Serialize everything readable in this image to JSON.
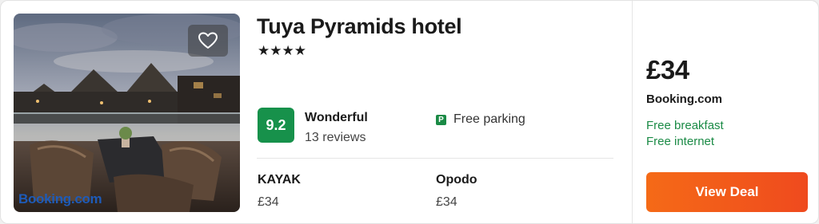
{
  "hotel": {
    "name": "Tuya Pyramids hotel",
    "stars": "★★★★"
  },
  "photo": {
    "watermark": "Booking.com",
    "favorite_icon": "heart-icon"
  },
  "rating": {
    "score": "9.2",
    "label": "Wonderful",
    "reviews": "13 reviews"
  },
  "amenities": [
    {
      "icon": "parking-icon",
      "icon_glyph": "P",
      "label": "Free parking"
    }
  ],
  "providers": [
    {
      "name": "KAYAK",
      "price": "£34"
    },
    {
      "name": "Opodo",
      "price": "£34"
    }
  ],
  "deal": {
    "price": "£34",
    "provider": "Booking.com",
    "perks": [
      "Free breakfast",
      "Free internet"
    ],
    "button_label": "View Deal"
  },
  "colors": {
    "score_bg": "#17914b",
    "perk_text": "#1a8a45",
    "button": "#f25a1a"
  }
}
